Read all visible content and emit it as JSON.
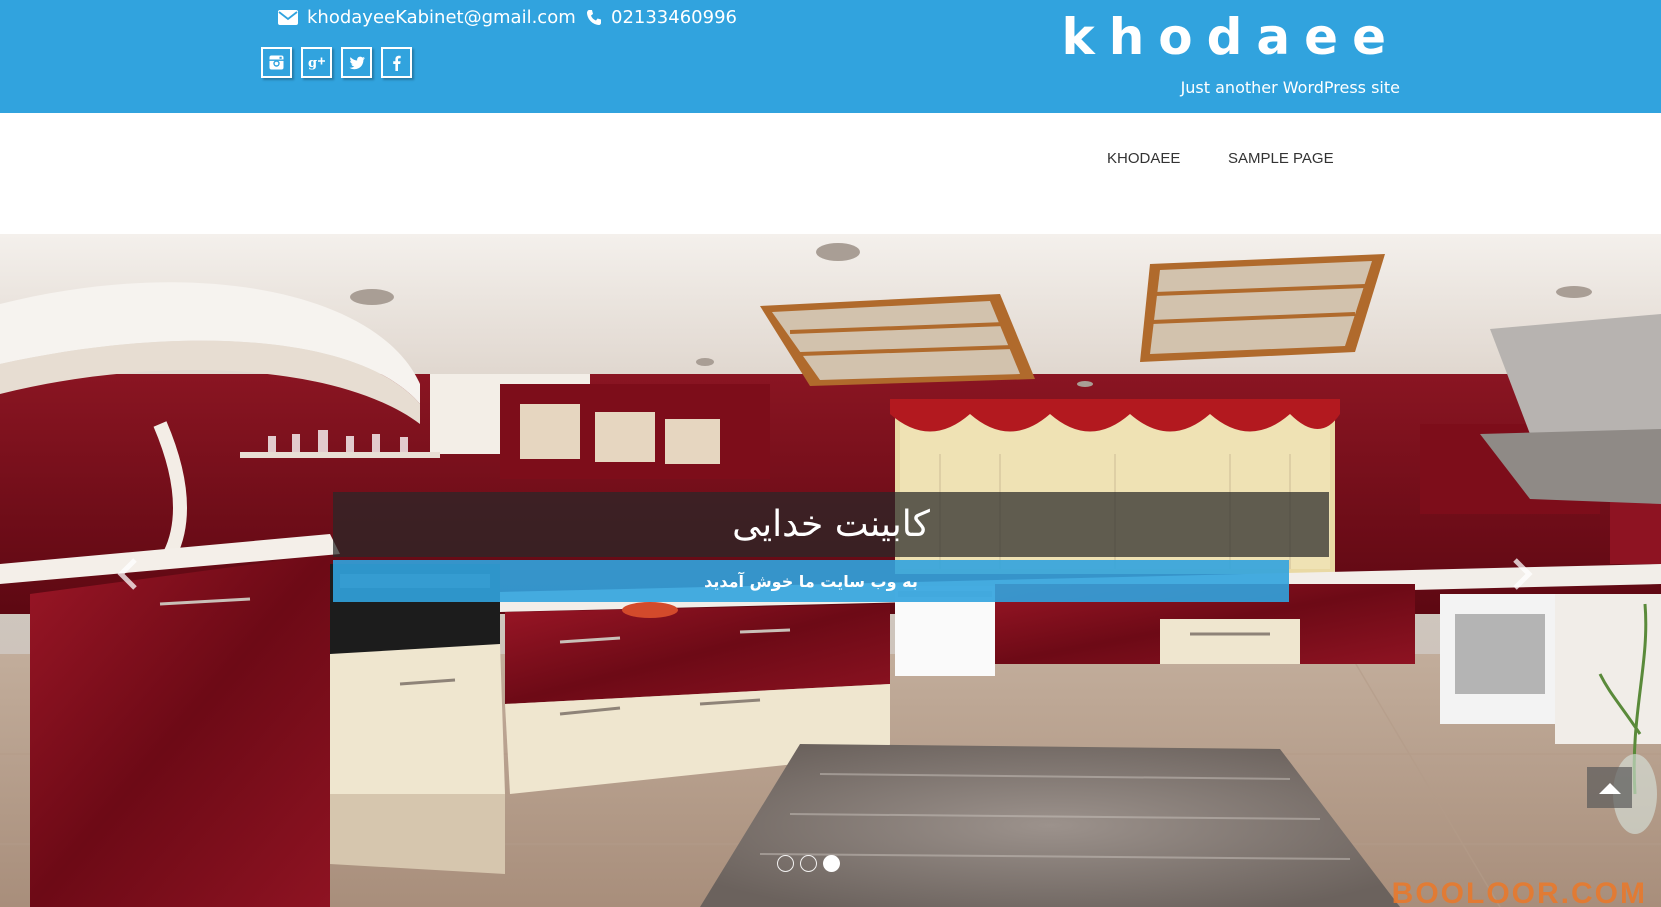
{
  "header": {
    "email": "khodayeeKabinet@gmail.com",
    "phone": "02133460996",
    "site_title": "khodaee",
    "tagline": "Just another WordPress site",
    "socials": [
      {
        "icon": "instagram-icon",
        "glyph": "◙"
      },
      {
        "icon": "google-plus-icon",
        "glyph": "g+"
      },
      {
        "icon": "twitter-icon",
        "glyph": "🐦"
      },
      {
        "icon": "facebook-icon",
        "glyph": "f"
      }
    ]
  },
  "nav": {
    "items": [
      {
        "label": "KHODAEE"
      },
      {
        "label": "SAMPLE PAGE"
      }
    ]
  },
  "slider": {
    "caption_title": "کابینت خدایی",
    "caption_subtitle": "به وب سایت ما خوش آمدید",
    "slide_count": 3,
    "active_slide": 3,
    "watermark": "BOOLOOR.COM"
  },
  "colors": {
    "header_blue": "#31a3de",
    "cabinet_red": "#7d0d1a",
    "cabinet_cream": "#efe6cf"
  }
}
